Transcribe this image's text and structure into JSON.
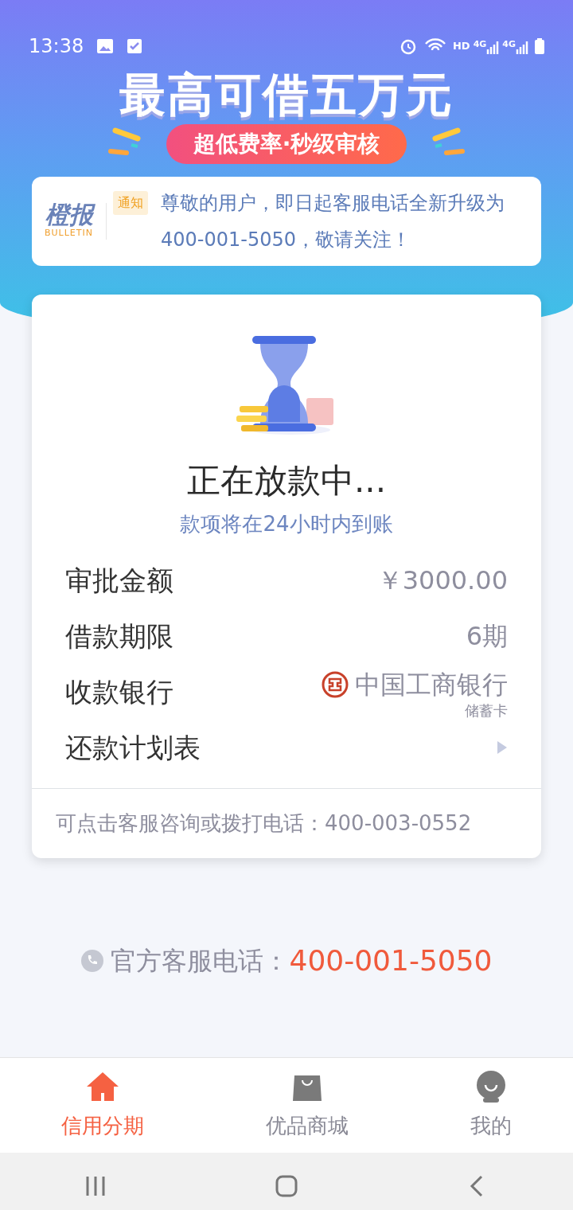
{
  "status_bar": {
    "time": "13:38",
    "network_label": "HD",
    "signal_labels": [
      "4G",
      "4G"
    ]
  },
  "banner": {
    "headline": "最高可借五万元",
    "tagline": "超低费率·秒级审核"
  },
  "bulletin": {
    "logo_text": "橙报",
    "logo_subtext": "BULLETIN",
    "tag": "通知",
    "message": "尊敬的用户，即日起客服电话全新升级为400-001-5050，敬请关注！"
  },
  "status_card": {
    "title": "正在放款中...",
    "subtitle": "款项将在24小时内到账",
    "rows": [
      {
        "kind": "text",
        "label": "审批金额",
        "value": "￥3000.00"
      },
      {
        "kind": "text",
        "label": "借款期限",
        "value": "6期"
      },
      {
        "kind": "bank",
        "label": "收款银行",
        "value": "中国工商银行",
        "subvalue": "储蓄卡"
      },
      {
        "kind": "link",
        "label": "还款计划表"
      }
    ],
    "footer": "可点击客服咨询或拨打电话：400-003-0552"
  },
  "hotline": {
    "label": "官方客服电话：",
    "number": "400-001-5050"
  },
  "bottom_nav": [
    {
      "label": "信用分期",
      "selected": true
    },
    {
      "label": "优品商城",
      "selected": false
    },
    {
      "label": "我的",
      "selected": false
    }
  ]
}
